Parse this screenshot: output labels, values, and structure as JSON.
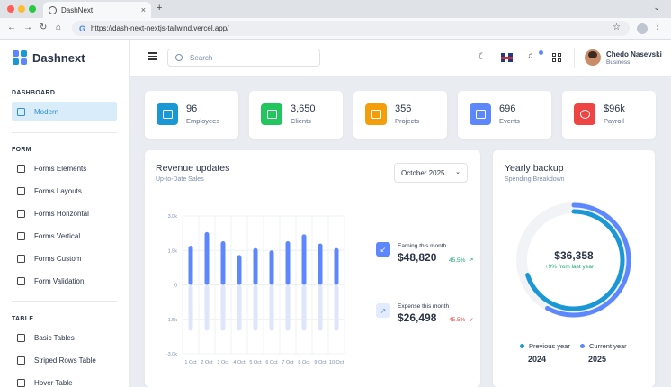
{
  "browser": {
    "tab_title": "DashNext",
    "url": "https://dash-next-nextjs-tailwind.vercel.app/",
    "new_tab_symbol": "+"
  },
  "app": {
    "name": "Dashnext"
  },
  "sidebar": {
    "sections": [
      {
        "title": "DASHBOARD",
        "items": [
          {
            "label": "Modern",
            "active": true
          }
        ]
      },
      {
        "title": "FORM",
        "items": [
          {
            "label": "Forms Elements"
          },
          {
            "label": "Forms Layouts"
          },
          {
            "label": "Forms Horizontal"
          },
          {
            "label": "Forms Vertical"
          },
          {
            "label": "Forms Custom"
          },
          {
            "label": "Form Validation"
          }
        ]
      },
      {
        "title": "TABLE",
        "items": [
          {
            "label": "Basic Tables"
          },
          {
            "label": "Striped Rows Table"
          },
          {
            "label": "Hover Table"
          }
        ]
      }
    ]
  },
  "header": {
    "search_placeholder": "Search",
    "user": {
      "name": "Chedo Nasevski",
      "role": "Business"
    }
  },
  "stats": [
    {
      "value": "96",
      "label": "Employees",
      "color": "#1a97d5"
    },
    {
      "value": "3,650",
      "label": "Clients",
      "color": "#22c55e"
    },
    {
      "value": "356",
      "label": "Projects",
      "color": "#f59e0b"
    },
    {
      "value": "696",
      "label": "Events",
      "color": "#5d87ff"
    },
    {
      "value": "$96k",
      "label": "Payroll",
      "color": "#ef4444"
    }
  ],
  "revenue": {
    "title": "Revenue updates",
    "subtitle": "Up-to-Date Sales",
    "period": "October 2025",
    "earning": {
      "label": "Earning this month",
      "value": "$48,820",
      "pct": "45.5%"
    },
    "expense": {
      "label": "Expense this month",
      "value": "$26,498",
      "pct": "45.5%"
    }
  },
  "backup": {
    "title": "Yearly backup",
    "subtitle": "Spending Breakdown",
    "total": "$36,358",
    "change": "+9% from last year",
    "legend": [
      {
        "label": "Previous year",
        "year": "2024",
        "color": "#1a97d5"
      },
      {
        "label": "Current year",
        "year": "2025",
        "color": "#5d87ff"
      }
    ]
  },
  "chart_data": [
    {
      "type": "bar",
      "categories": [
        "1 Oct",
        "2 Oct",
        "3 Oct",
        "4 Oct",
        "5 Oct",
        "6 Oct",
        "7 Oct",
        "8 Oct",
        "9 Oct",
        "10 Oct"
      ],
      "series": [
        {
          "values": [
            1.7,
            2.3,
            1.9,
            1.3,
            1.6,
            1.5,
            1.9,
            2.2,
            1.8,
            1.6
          ],
          "color": "#5d87ff"
        },
        {
          "values": [
            -2.0,
            -2.0,
            -2.0,
            -2.0,
            -2.0,
            -2.0,
            -2.0,
            -2.0,
            -2.0,
            -2.0
          ],
          "color": "#dfe6fb"
        }
      ],
      "yticks": [
        "3.0k",
        "1.5k",
        "0",
        "-1.5k",
        "-3.0k"
      ],
      "ylim": [
        -3.0,
        3.0
      ]
    },
    {
      "type": "pie",
      "series": [
        {
          "year": "2024",
          "value": 70,
          "color": "#1a97d5"
        },
        {
          "year": "2025",
          "value": 58,
          "color": "#5d87ff"
        }
      ]
    }
  ]
}
